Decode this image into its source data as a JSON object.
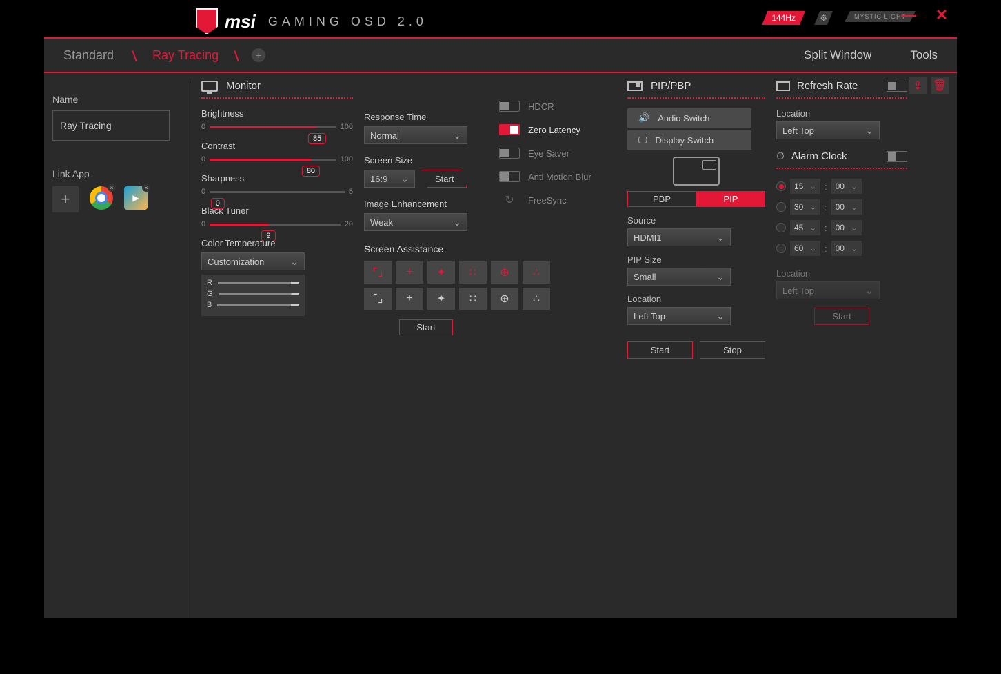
{
  "brand": "msi",
  "brand_sub": "GAMING OSD 2.0",
  "hz": "144Hz",
  "mystic": "MYSTIC LIGHT",
  "nav": {
    "standard": "Standard",
    "ray": "Ray Tracing",
    "split": "Split Window",
    "tools": "Tools"
  },
  "name_label": "Name",
  "name_value": "Ray Tracing",
  "link_app": "Link App",
  "monitor": {
    "title": "Monitor",
    "brightness": {
      "label": "Brightness",
      "min": "0",
      "max": "100",
      "value": "85"
    },
    "contrast": {
      "label": "Contrast",
      "min": "0",
      "max": "100",
      "value": "80"
    },
    "sharpness": {
      "label": "Sharpness",
      "min": "0",
      "max": "5",
      "value": "0"
    },
    "black_tuner": {
      "label": "Black Tuner",
      "min": "0",
      "max": "20",
      "value": "9"
    },
    "color_temp": {
      "label": "Color Temperature",
      "value": "Customization",
      "r": "R",
      "g": "G",
      "b": "B"
    }
  },
  "response": {
    "rt_label": "Response Time",
    "rt_value": "Normal",
    "ss_label": "Screen Size",
    "ss_value": "16:9",
    "ss_start": "Start",
    "ie_label": "Image Enhancement",
    "ie_value": "Weak",
    "sa_label": "Screen Assistance",
    "sa_start": "Start"
  },
  "toggles": {
    "hdcr": "HDCR",
    "zero": "Zero Latency",
    "eye": "Eye Saver",
    "amb": "Anti Motion Blur",
    "fs": "FreeSync"
  },
  "pip": {
    "title": "PIP/PBP",
    "audio": "Audio Switch",
    "display": "Display Switch",
    "pbp": "PBP",
    "pip": "PIP",
    "source_label": "Source",
    "source": "HDMI1",
    "size_label": "PIP Size",
    "size": "Small",
    "loc_label": "Location",
    "loc": "Left Top",
    "start": "Start",
    "stop": "Stop"
  },
  "rr": {
    "title": "Refresh Rate",
    "loc_label": "Location",
    "loc": "Left Top",
    "alarm": "Alarm Clock",
    "times": [
      {
        "h": "15",
        "m": "00",
        "on": true
      },
      {
        "h": "30",
        "m": "00",
        "on": false
      },
      {
        "h": "45",
        "m": "00",
        "on": false
      },
      {
        "h": "60",
        "m": "00",
        "on": false
      }
    ],
    "loc2_label": "Location",
    "loc2": "Left Top",
    "start": "Start"
  }
}
